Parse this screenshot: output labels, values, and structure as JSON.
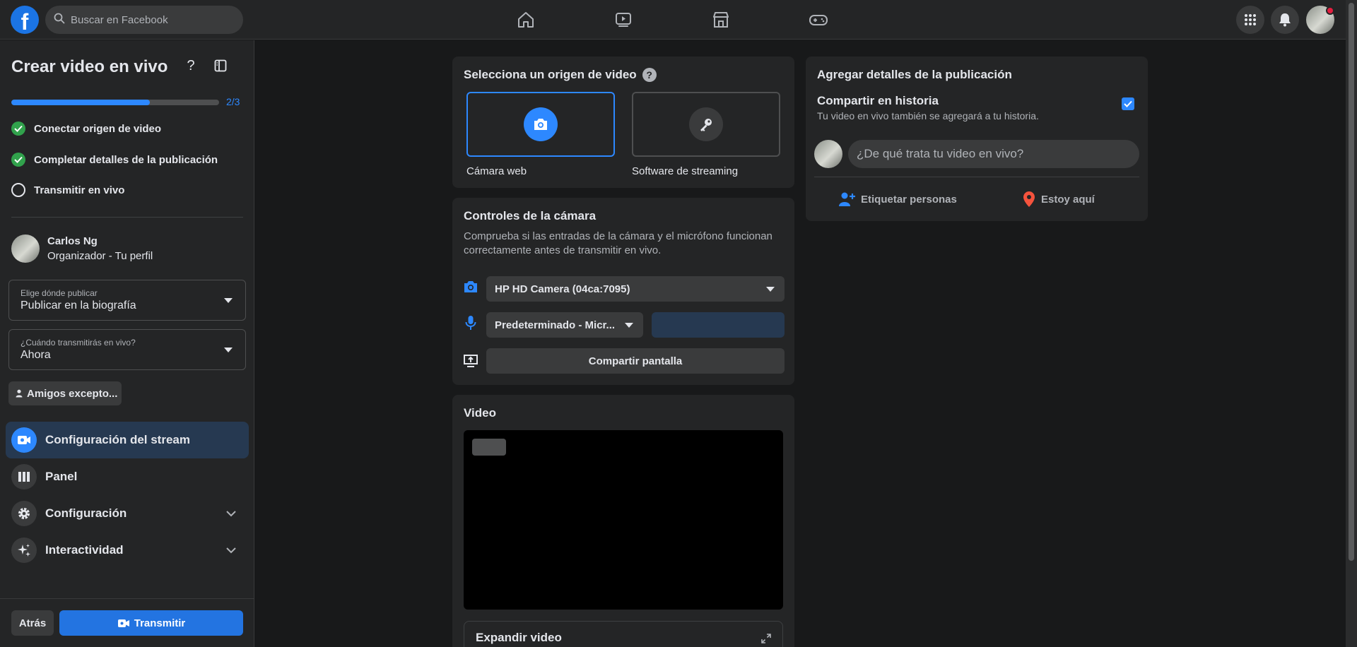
{
  "topbar": {
    "search_placeholder": "Buscar en Facebook"
  },
  "sidebar": {
    "title": "Crear video en vivo",
    "help": "?",
    "progress_label": "2/3",
    "progress_fraction": 0.667,
    "steps": [
      {
        "label": "Conectar origen de video",
        "done": true
      },
      {
        "label": "Completar detalles de la publicación",
        "done": true
      },
      {
        "label": "Transmitir en vivo",
        "done": false
      }
    ],
    "profile": {
      "name": "Carlos Ng",
      "subtitle": "Organizador - Tu perfil"
    },
    "publish_where": {
      "label": "Elige dónde publicar",
      "value": "Publicar en la biografía"
    },
    "publish_when": {
      "label": "¿Cuándo transmitirás en vivo?",
      "value": "Ahora"
    },
    "audience_button": "Amigos excepto...",
    "menu": [
      {
        "label": "Configuración del stream",
        "icon": "video-camera-icon",
        "active": true
      },
      {
        "label": "Panel",
        "icon": "panel-icon",
        "active": false
      },
      {
        "label": "Configuración",
        "icon": "gear-icon",
        "active": false
      },
      {
        "label": "Interactividad",
        "icon": "sparkle-icon",
        "active": false
      }
    ],
    "back_button": "Atrás",
    "go_live_button": "Transmitir"
  },
  "video_source": {
    "title": "Selecciona un origen de video",
    "options": [
      {
        "label": "Cámara web",
        "icon": "camera-icon",
        "selected": true
      },
      {
        "label": "Software de streaming",
        "icon": "key-icon",
        "selected": false
      }
    ]
  },
  "camera_controls": {
    "title": "Controles de la cámara",
    "description": "Comprueba si las entradas de la cámara y el micrófono funcionan correctamente antes de transmitir en vivo.",
    "camera_value": "HP HD Camera (04ca:7095)",
    "mic_value": "Predeterminado - Micr...",
    "share_screen": "Compartir pantalla"
  },
  "video": {
    "title": "Video",
    "expand_label": "Expandir video"
  },
  "post_details": {
    "title": "Agregar detalles de la publicación",
    "share_story_title": "Compartir en historia",
    "share_story_desc": "Tu video en vivo también se agregará a tu historia.",
    "share_story_checked": true,
    "post_placeholder": "¿De qué trata tu video en vivo?",
    "tag_people": "Etiquetar personas",
    "check_in": "Estoy aquí"
  },
  "colors": {
    "accent": "#2d88ff",
    "success": "#31a24c",
    "location": "#f5533d",
    "background": "#18191a",
    "surface": "#242526"
  }
}
